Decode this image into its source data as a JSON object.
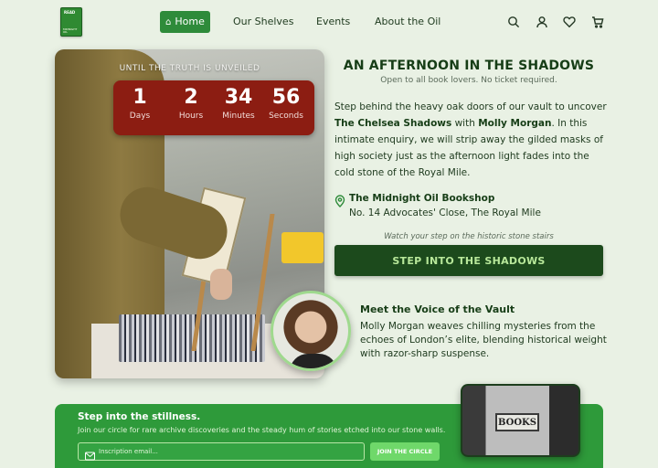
{
  "logo": {
    "top_text": "READ",
    "bottom_text": "MIDNIGHT OIL"
  },
  "nav": {
    "home": "Home",
    "shelves": "Our Shelves",
    "events": "Events",
    "about": "About the Oil",
    "icons": [
      "search-icon",
      "user-icon",
      "heart-icon",
      "cart-icon"
    ]
  },
  "countdown": {
    "label": "UNTIL THE TRUTH IS UNVEILED",
    "items": [
      {
        "value": "1",
        "unit": "Days"
      },
      {
        "value": "2",
        "unit": "Hours"
      },
      {
        "value": "34",
        "unit": "Minutes"
      },
      {
        "value": "56",
        "unit": "Seconds"
      }
    ]
  },
  "event": {
    "title": "AN AFTERNOON IN THE SHADOWS",
    "subtitle": "Open to all book lovers. No ticket required.",
    "desc_1": "Step behind the heavy oak doors of our vault to uncover ",
    "desc_book": "The Chelsea Shadows",
    "desc_2": " with ",
    "desc_author": "Molly Morgan",
    "desc_3": ". In this intimate enquiry, we will strip away the gilded masks of high society just as the afternoon light fades into the cold stone of the Royal Mile.",
    "venue_name": "The Midnight Oil Bookshop",
    "venue_address": "No. 14 Advocates' Close, The Royal Mile",
    "cta_note": "Watch your step on the historic stone stairs",
    "cta_label": "STEP INTO THE SHADOWS"
  },
  "author": {
    "heading": "Meet the Voice of the Vault",
    "bio": "Molly Morgan weaves chilling mysteries from the echoes of London’s elite, blending historical weight with razor-sharp suspense."
  },
  "newsletter": {
    "title": "Step into the stillness.",
    "text": "Join our circle for rare archive discoveries and the steady hum of stories etched into our stone walls.",
    "placeholder": "Inscription email...",
    "button": "JOIN THE CIRCLE",
    "photo_sign": "BOOKS"
  },
  "colors": {
    "background": "#e9f1e4",
    "primary_green": "#2e8b3a",
    "dark_green": "#1c4a1c",
    "countdown_red": "#8c1d12",
    "newsletter_green": "#2e9a3a"
  }
}
